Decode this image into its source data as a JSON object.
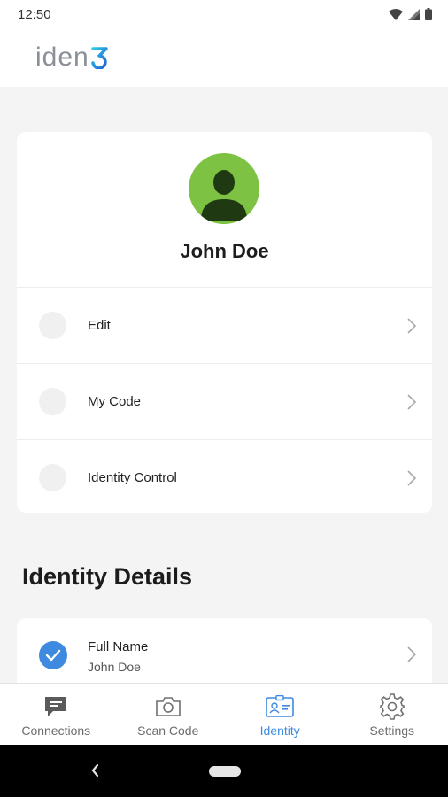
{
  "status_bar": {
    "time": "12:50"
  },
  "header": {
    "logo_text": "iden",
    "logo_mark": "3"
  },
  "profile": {
    "name": "John Doe",
    "avatar_color": "#7dc242",
    "menu_items": [
      {
        "label": "Edit"
      },
      {
        "label": "My Code"
      },
      {
        "label": "Identity Control"
      }
    ]
  },
  "identity_details": {
    "title": "Identity Details",
    "items": [
      {
        "label": "Full Name",
        "value": "John Doe",
        "verified": true
      }
    ]
  },
  "bottom_nav": {
    "active": "Identity",
    "items": [
      {
        "label": "Connections",
        "icon": "chat-icon"
      },
      {
        "label": "Scan Code",
        "icon": "camera-icon"
      },
      {
        "label": "Identity",
        "icon": "id-card-icon"
      },
      {
        "label": "Settings",
        "icon": "gear-icon"
      }
    ]
  },
  "colors": {
    "accent": "#3d8ae0",
    "background": "#f4f4f4",
    "avatar": "#7dc242"
  }
}
